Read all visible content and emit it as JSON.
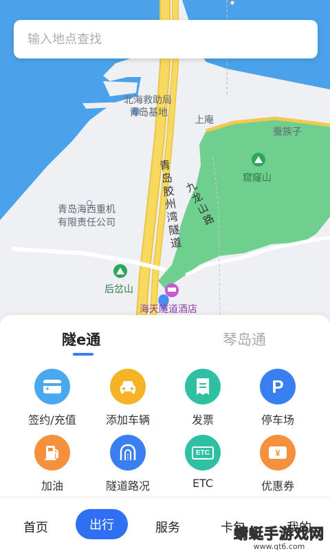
{
  "search": {
    "placeholder": "输入地点查找"
  },
  "map": {
    "labels": {
      "rescue_1": "北海救助局",
      "rescue_2": "青岛基地",
      "shangan": "上庵",
      "canzuzi": "蚕族子",
      "kulong": "窟窿山",
      "tunnel_1": "青",
      "tunnel_2": "岛",
      "tunnel_3": "胶",
      "tunnel_4": "州",
      "tunnel_5": "湾",
      "tunnel_6": "隧",
      "tunnel_7": "道",
      "road_1": "九",
      "road_2": "龙",
      "road_3": "山",
      "road_4": "路",
      "company_1": "青岛海西重机",
      "company_2": "有限责任公司",
      "houchashan": "后岔山",
      "hotel": "海天隧道酒店"
    },
    "colors": {
      "water": "#4aa3ea",
      "land": "#eef0f3",
      "park": "#6fcf8e",
      "road": "#f5d25a"
    }
  },
  "tabs": {
    "active": "隧e通",
    "inactive": "琴岛通"
  },
  "services": [
    {
      "label": "签约/充值",
      "icon": "card-icon",
      "color": "#4aa8ee"
    },
    {
      "label": "添加车辆",
      "icon": "car-icon",
      "color": "#f5b325"
    },
    {
      "label": "发票",
      "icon": "invoice-icon",
      "color": "#2fc0a3"
    },
    {
      "label": "停车场",
      "icon": "parking-icon",
      "color": "#3a7ff0"
    },
    {
      "label": "加油",
      "icon": "fuel-icon",
      "color": "#f5903c"
    },
    {
      "label": "隧道路况",
      "icon": "tunnel-icon",
      "color": "#3a7ff0"
    },
    {
      "label": "ETC",
      "icon": "etc-icon",
      "color": "#2fc0a3"
    },
    {
      "label": "优惠券",
      "icon": "coupon-icon",
      "color": "#f5903c"
    }
  ],
  "etc_badge": "ETC",
  "coupon_symbol": "¥",
  "parking_symbol": "P",
  "nav": {
    "home": "首页",
    "travel": "出行",
    "service": "服务",
    "card": "卡包",
    "mine": "我的"
  },
  "watermark": {
    "main": "蜻蜓手游戏网",
    "url": "www.qt6.com"
  }
}
